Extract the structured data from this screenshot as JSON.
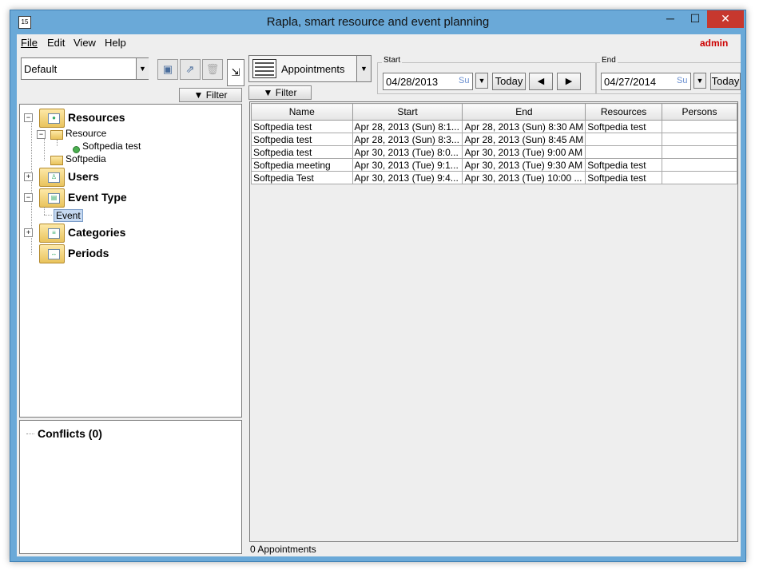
{
  "window": {
    "title": "Rapla, smart resource and event planning",
    "icon_text": "15",
    "minimize_glyph": "─",
    "maximize_glyph": "☐",
    "close_glyph": "✕"
  },
  "menubar": {
    "items": [
      "File",
      "Edit",
      "View",
      "Help"
    ],
    "user": "admin"
  },
  "left_toolbar": {
    "view_select": "Default",
    "filter_label": "Filter"
  },
  "tree": {
    "resources": "Resources",
    "resource_type": "Resource",
    "resource_item": "Softpedia test",
    "softpedia": "Softpedia",
    "users": "Users",
    "event_type": "Event Type",
    "event": "Event",
    "categories": "Categories",
    "periods": "Periods"
  },
  "conflicts": {
    "label": "Conflicts (0)"
  },
  "right_toolbar": {
    "view_label": "Appointments",
    "filter_label": "Filter",
    "start_group_title": "Start",
    "start_date": "04/28/2013",
    "start_day": "Su",
    "end_group_title": "End",
    "end_date": "04/27/2014",
    "end_day": "Su",
    "today_label": "Today"
  },
  "table": {
    "columns": [
      "Name",
      "Start",
      "End",
      "Resources",
      "Persons"
    ],
    "rows": [
      [
        "Softpedia test",
        "Apr 28, 2013 (Sun) 8:1...",
        "Apr 28, 2013 (Sun) 8:30 AM",
        "Softpedia test",
        ""
      ],
      [
        "Softpedia test",
        "Apr 28, 2013 (Sun) 8:3...",
        "Apr 28, 2013 (Sun) 8:45 AM",
        "",
        ""
      ],
      [
        "Softpedia test",
        "Apr 30, 2013 (Tue) 8:0...",
        "Apr 30, 2013 (Tue) 9:00 AM",
        "",
        ""
      ],
      [
        "Softpedia meeting",
        "Apr 30, 2013 (Tue) 9:1...",
        "Apr 30, 2013 (Tue) 9:30 AM",
        "Softpedia test",
        ""
      ],
      [
        "Softpedia Test",
        "Apr 30, 2013 (Tue) 9:4...",
        "Apr 30, 2013 (Tue) 10:00 ...",
        "Softpedia test",
        ""
      ]
    ]
  },
  "status": "0 Appointments",
  "colors": {
    "frame": "#6aa9d8",
    "close_button": "#c7382e",
    "user_label": "#cc0000",
    "selection": "#c6d9f1"
  },
  "icons": {
    "save": "save-icon",
    "export": "export-icon",
    "delete": "trash-icon",
    "collapse": "collapse-icon",
    "prev": "left-arrow-icon",
    "next": "right-arrow-icon"
  }
}
